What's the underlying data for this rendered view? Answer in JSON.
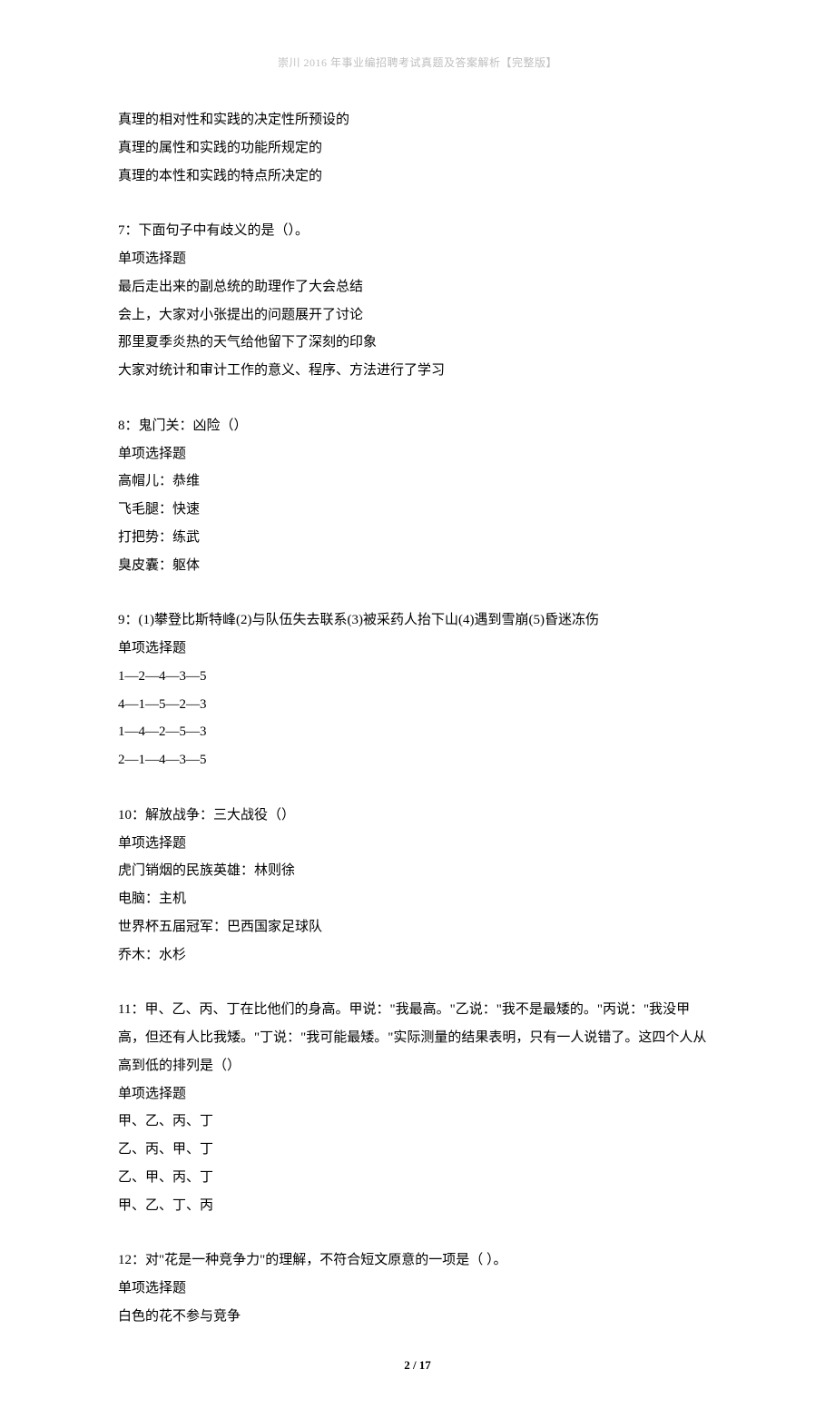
{
  "header": {
    "title": "崇川 2016 年事业编招聘考试真题及答案解析【完整版】"
  },
  "blocks": [
    {
      "lines": [
        "真理的相对性和实践的决定性所预设的",
        "真理的属性和实践的功能所规定的",
        "真理的本性和实践的特点所决定的"
      ]
    },
    {
      "lines": [
        "7：下面句子中有歧义的是（）。",
        "单项选择题",
        "最后走出来的副总统的助理作了大会总结",
        "会上，大家对小张提出的问题展开了讨论",
        "那里夏季炎热的天气给他留下了深刻的印象",
        "大家对统计和审计工作的意义、程序、方法进行了学习"
      ]
    },
    {
      "lines": [
        "8：鬼门关：凶险（）",
        "单项选择题",
        "高帽儿：恭维",
        "飞毛腿：快速",
        "打把势：练武",
        "臭皮囊：躯体"
      ]
    },
    {
      "lines": [
        "9：(1)攀登比斯特峰(2)与队伍失去联系(3)被采药人抬下山(4)遇到雪崩(5)昏迷冻伤",
        "单项选择题",
        "1—2—4—3—5",
        "4—1—5—2—3",
        "1—4—2—5—3",
        "2—1—4—3—5"
      ]
    },
    {
      "lines": [
        "10：解放战争：三大战役（）",
        "单项选择题",
        "虎门销烟的民族英雄：林则徐",
        "电脑：主机",
        "世界杯五届冠军：巴西国家足球队",
        "乔木：水杉"
      ]
    },
    {
      "lines": [
        "11：甲、乙、丙、丁在比他们的身高。甲说：\"我最高。\"乙说：\"我不是最矮的。\"丙说：\"我没甲高，但还有人比我矮。\"丁说：\"我可能最矮。\"实际测量的结果表明，只有一人说错了。这四个人从高到低的排列是（）",
        "单项选择题",
        "甲、乙、丙、丁",
        "乙、丙、甲、丁",
        "乙、甲、丙、丁",
        "甲、乙、丁、丙"
      ]
    },
    {
      "lines": [
        "12：对\"花是一种竞争力\"的理解，不符合短文原意的一项是（  ）。",
        "单项选择题",
        "白色的花不参与竞争"
      ]
    }
  ],
  "footer": {
    "page_number": "2 / 17"
  }
}
